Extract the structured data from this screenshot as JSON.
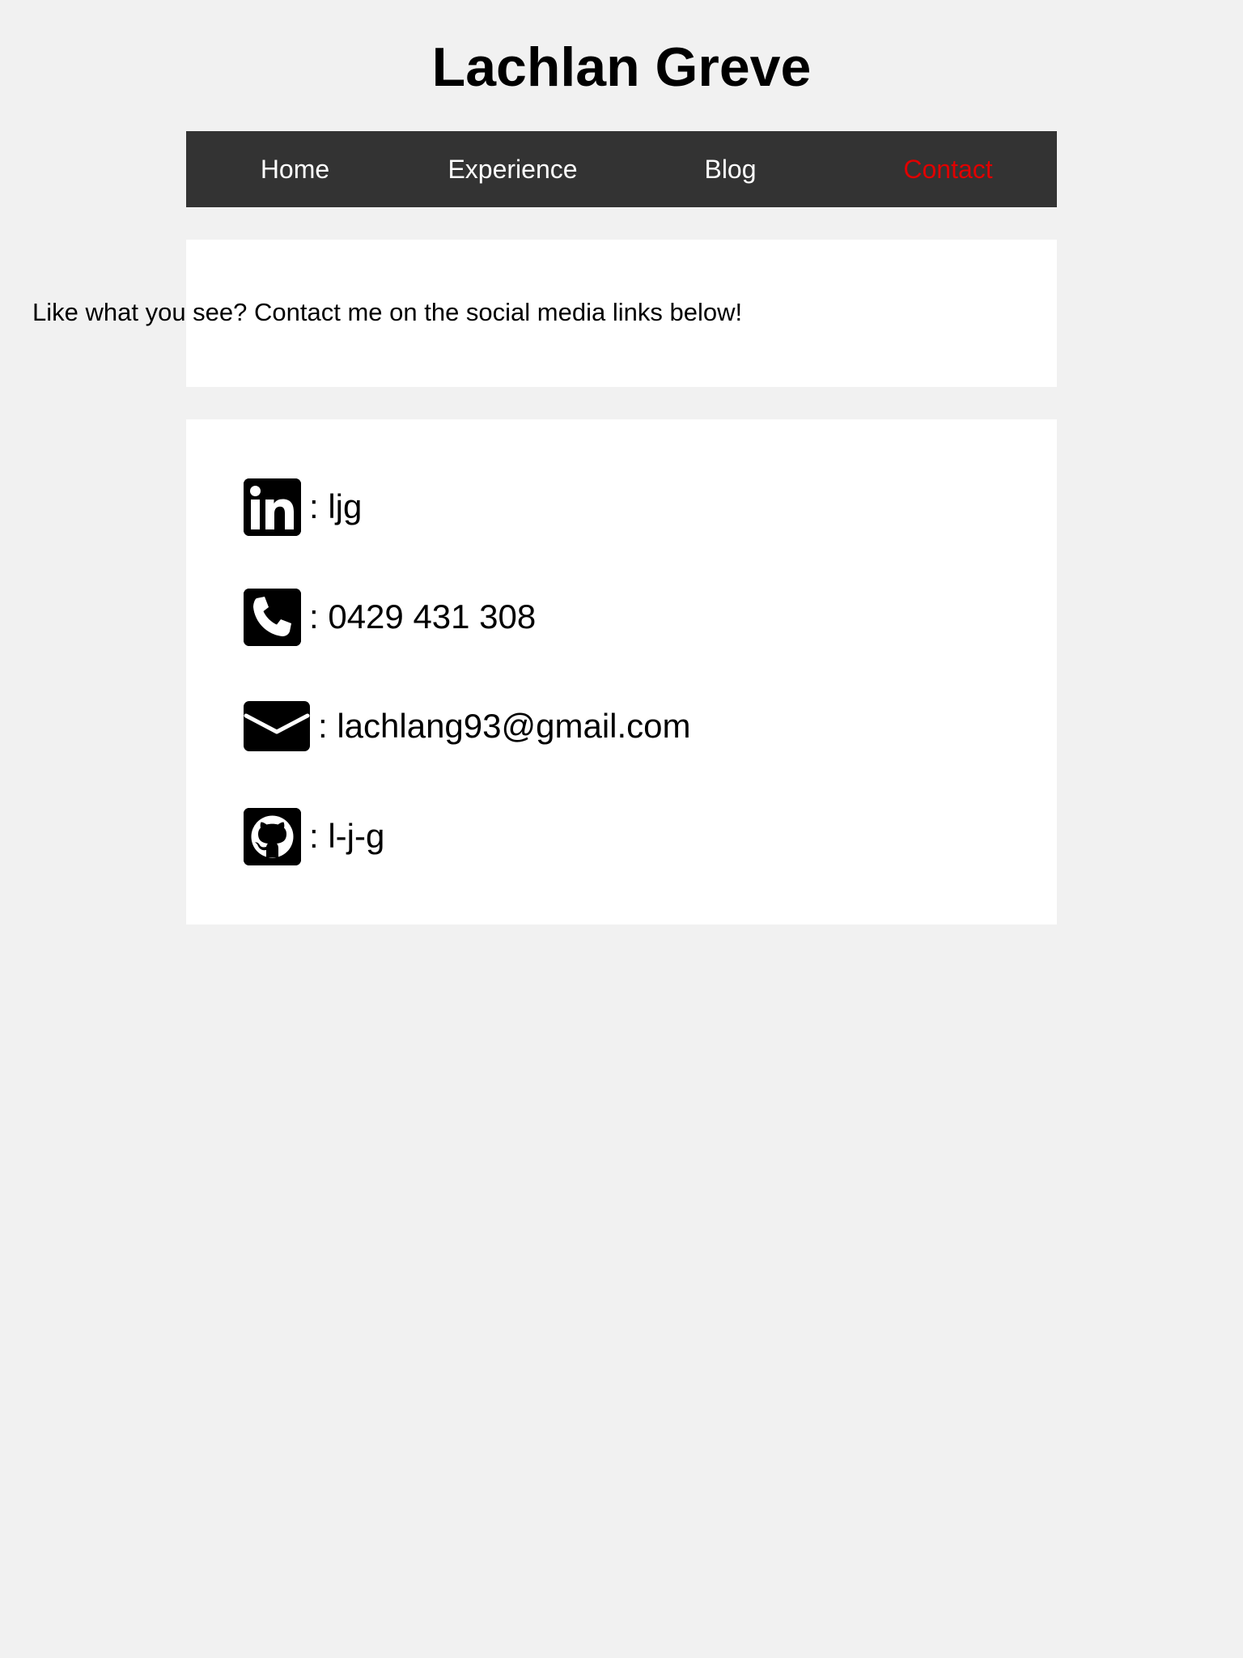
{
  "header": {
    "title": "Lachlan Greve"
  },
  "nav": {
    "items": [
      {
        "label": "Home"
      },
      {
        "label": "Experience"
      },
      {
        "label": "Blog"
      },
      {
        "label": "Contact",
        "active": true
      }
    ],
    "active_color": "#e00000",
    "background_color": "#333333"
  },
  "intro": {
    "text": "Like what you see? Contact me on the social media links below!"
  },
  "contacts": [
    {
      "icon": "linkedin-icon",
      "value": ": ljg"
    },
    {
      "icon": "phone-icon",
      "value": ": 0429 431 308"
    },
    {
      "icon": "envelope-icon",
      "value": ": lachlang93@gmail.com"
    },
    {
      "icon": "github-icon",
      "value": ": l-j-g"
    }
  ]
}
